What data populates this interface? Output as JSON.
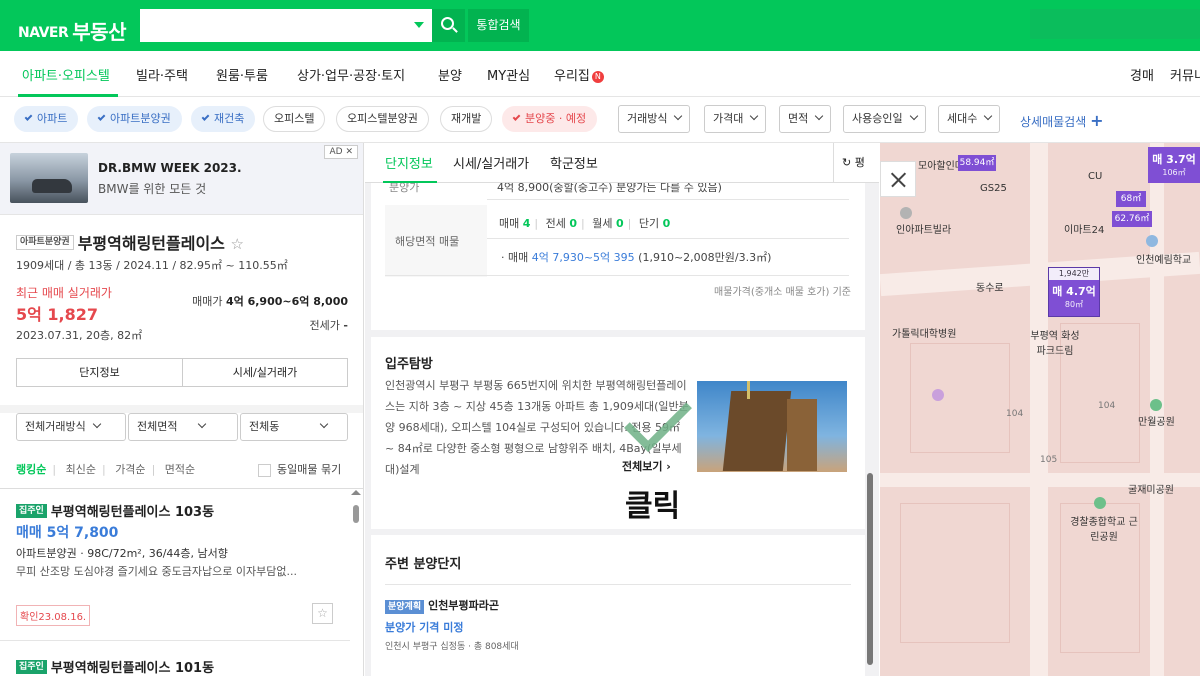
{
  "header": {
    "brand": "NAVER",
    "service": "부동산",
    "integrated_search": "통합검색"
  },
  "nav": {
    "items": [
      "아파트·오피스텔",
      "빌라·주택",
      "원룸·투룸",
      "상가·업무·공장·토지",
      "분양",
      "MY관심",
      "우리집",
      "경매",
      "커뮤니"
    ],
    "new_badge": "N",
    "active_index": 0
  },
  "filters": {
    "chips": [
      "아파트",
      "아파트분양권",
      "재건축",
      "오피스텔",
      "오피스텔분양권",
      "재개발",
      "분양중 · 예정"
    ],
    "selects": [
      "거래방식",
      "가격대",
      "면적",
      "사용승인일",
      "세대수"
    ],
    "advanced": "상세매물검색",
    "plus": "+"
  },
  "ad": {
    "title": "DR.BMW WEEK 2023.",
    "subtitle": "BMW를 위한 모든 것",
    "tag": "AD",
    "close": "✕"
  },
  "complex": {
    "type_tag": "아파트분양권",
    "name": "부평역해링턴플레이스",
    "star": "☆",
    "info": "1909세대 / 총 13동 / 2024.11 / 82.95㎡ ~ 110.55㎡",
    "recent_label": "최근 매매 실거래가",
    "recent_price": "5억 1,827",
    "recent_meta": "2023.07.31, 20층, 82㎡",
    "sale_label": "매매가",
    "sale_range": "4억 6,900~6억 8,000",
    "jeonse_label": "전세가",
    "jeonse_value": "-",
    "tab1": "단지정보",
    "tab2": "시세/실거래가"
  },
  "list_filters": [
    "전체거래방식",
    "전체면적",
    "전체동"
  ],
  "sorts": [
    "랭킹순",
    "최신순",
    "가격순",
    "면적순"
  ],
  "same_listing": "동일매물 묶기",
  "listings": [
    {
      "tag": "집주인",
      "title": "부평역해링턴플레이스 103동",
      "price": "매매 5억 7,800",
      "spec": "아파트분양권 · 98C/72m², 36/44층, 남서향",
      "desc": "무피 산조망 도심야경 즐기세요 중도금자납으로 이자부담없...",
      "confirm": "확인23.08.16.",
      "star": "☆"
    },
    {
      "tag": "집주인",
      "title": "부평역해링턴플레이스 101동"
    }
  ],
  "detail_tabs": [
    "단지정보",
    "시세/실거래가",
    "학군정보"
  ],
  "detail_right_tab": "평",
  "detail": {
    "cut_label": "분양가",
    "cut_value": "4억 8,900(중할(중고수) 분양가는 다를 수 있음)",
    "area_listing_label": "해당면적 매물",
    "type_counts": [
      {
        "label": "매매",
        "count": "4"
      },
      {
        "label": "전세",
        "count": "0"
      },
      {
        "label": "월세",
        "count": "0"
      },
      {
        "label": "단기",
        "count": "0"
      }
    ],
    "sale_prefix": "· 매매",
    "sale_range": "4억 7,930~5억 395",
    "sale_unit": "(1,910~2,008만원/3.3㎡)",
    "note": "매물가격(중개소 매물 호가) 기준"
  },
  "tour": {
    "title": "입주탐방",
    "text": "인천광역시 부평구 부평동 665번지에 위치한 부평역해링턴플레이스는 지하 3층 ~ 지상 45층 13개동 아파트 총 1,909세대(일반분양 968세대), 오피스텔 104실로 구성되어 있습니다. 전용 59㎡ ~ 84㎡로 다양한 중소형 평형으로 남향위주 배치, 4Bay(일부세대)설계",
    "more": "전체보기 ›",
    "click_label": "클릭"
  },
  "nearby": {
    "title": "주변 분양단지",
    "tag": "분양계획",
    "name": "인천부평파라곤",
    "price": "분양가 기격 미정",
    "address": "인천시 부평구 십정동 · 총 808세대"
  },
  "map": {
    "pois": [
      "모아할인마트",
      "GS25",
      "CU",
      "인아파트빌라",
      "이마트24",
      "인천예림학교",
      "동수로",
      "가톨릭대학병원",
      "부평역 화성파크드림",
      "만월공원",
      "굴재미공원",
      "경찰종합학교 근린공원"
    ],
    "block_numbers": [
      "104",
      "105",
      "104"
    ],
    "markers": [
      {
        "price": "매 3.7억",
        "area": "106㎡"
      },
      {
        "price": "58.94㎡"
      },
      {
        "price": "68㎡"
      },
      {
        "price": "62.76㎡"
      },
      {
        "price": "매 4.7억",
        "area": "80㎡",
        "top": "1,942만"
      }
    ]
  }
}
